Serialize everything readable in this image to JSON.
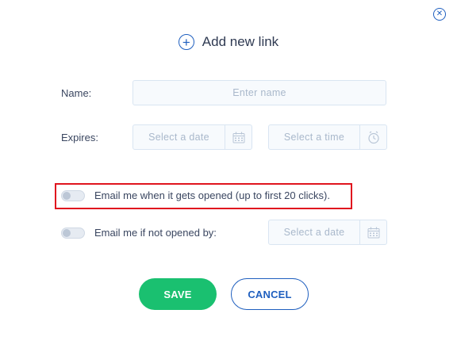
{
  "dialog": {
    "title": "Add new link",
    "close_icon": "close-circle-icon",
    "title_icon": "plus-circle-icon"
  },
  "form": {
    "name_label": "Name:",
    "name_placeholder": "Enter name",
    "name_value": "",
    "expires_label": "Expires:",
    "expires_date_placeholder": "Select a date",
    "expires_time_placeholder": "Select a time",
    "email_opened_label": "Email me when it gets opened (up to first 20 clicks).",
    "email_opened_on": false,
    "email_not_opened_label": "Email me if not opened by:",
    "email_not_opened_on": false,
    "not_opened_date_placeholder": "Select a date"
  },
  "actions": {
    "save_label": "SAVE",
    "cancel_label": "CANCEL"
  },
  "colors": {
    "accent": "#1f5fbf",
    "save": "#1ac070",
    "highlight": "#e0141e"
  }
}
